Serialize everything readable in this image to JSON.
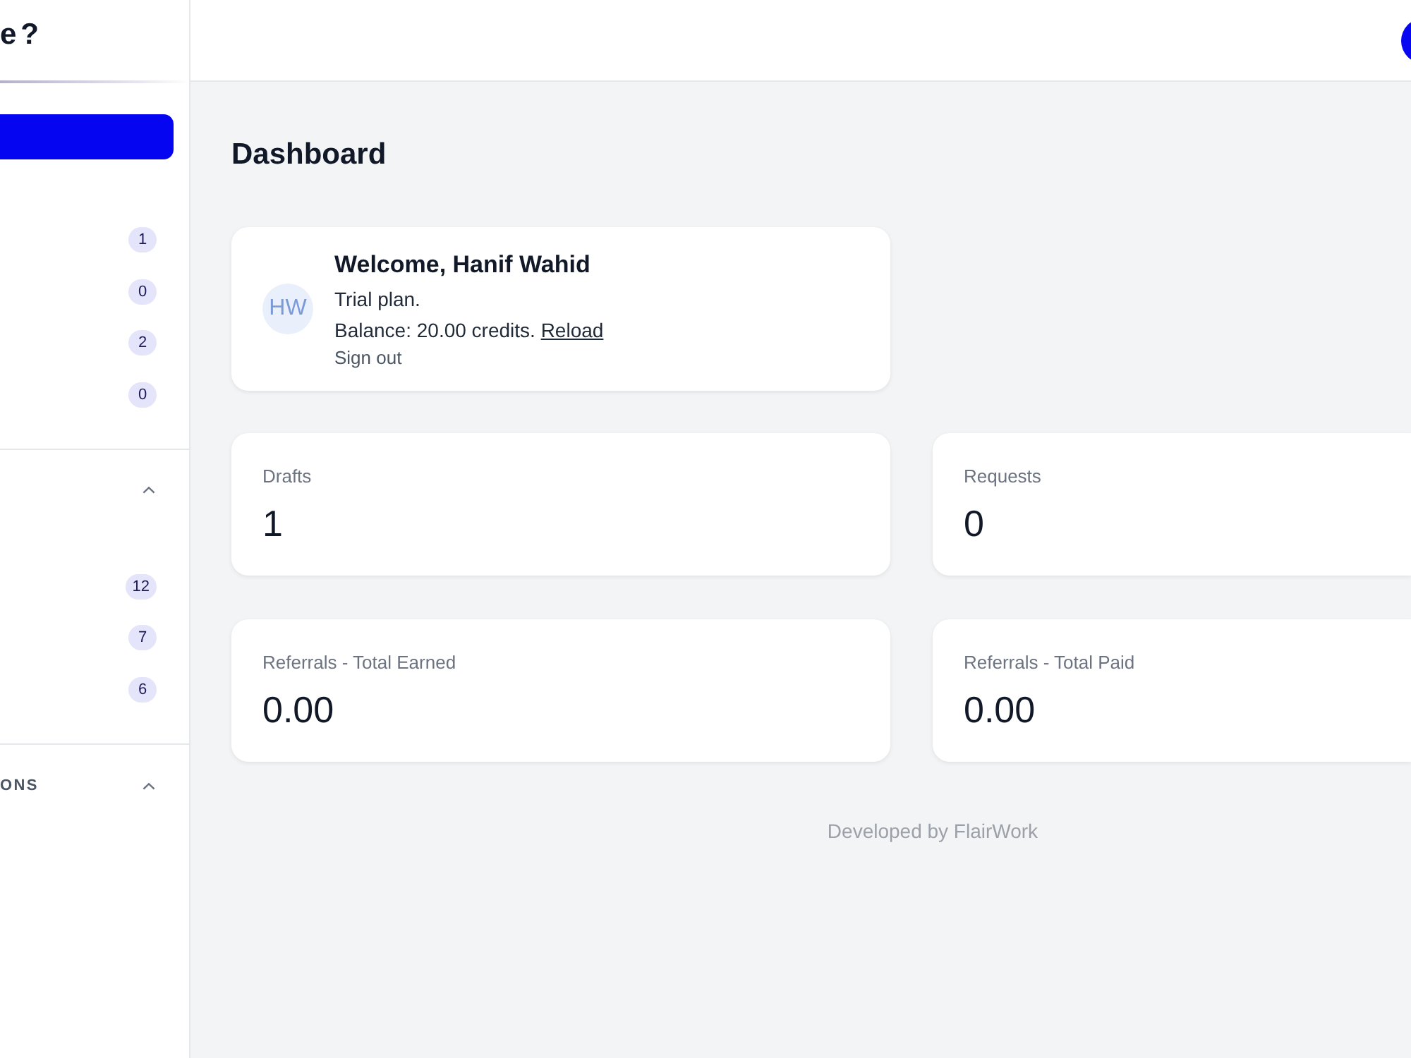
{
  "logo": {
    "text": "e?"
  },
  "sidebar": {
    "items": [
      {
        "count": "1"
      },
      {
        "count": "0"
      },
      {
        "count": "2"
      },
      {
        "count": "0"
      }
    ],
    "groups": [
      {
        "expanded": true,
        "items": [
          {
            "count": "12"
          },
          {
            "count": "7"
          },
          {
            "count": "6"
          }
        ]
      },
      {
        "title": "ONS",
        "expanded": true
      }
    ]
  },
  "page_title": "Dashboard",
  "welcome_card": {
    "initials": "HW",
    "title": "Welcome, Hanif Wahid",
    "plan": "Trial plan.",
    "balance": "Balance: 20.00 credits.",
    "reload_link": "Reload",
    "sign_out": "Sign out"
  },
  "stats": [
    {
      "label": "Drafts",
      "value": "1"
    },
    {
      "label": "Requests",
      "value": "0"
    },
    {
      "label": "Referrals - Total Earned",
      "value": "0.00"
    },
    {
      "label": "Referrals - Total Paid",
      "value": "0.00"
    }
  ],
  "footer": "Developed by FlairWork"
}
